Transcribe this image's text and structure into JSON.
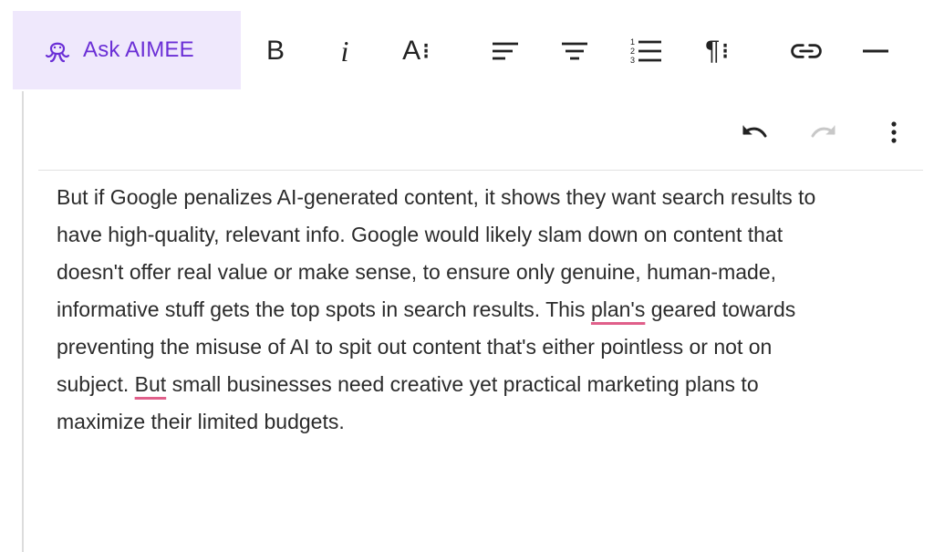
{
  "toolbar": {
    "ask_aimee_label": "Ask AIMEE",
    "bold_label": "B",
    "italic_label": "i",
    "font_size_label": "A",
    "font_size_dots": "⁝",
    "paragraph_label": "¶",
    "paragraph_dots": "⁝",
    "icons": {
      "ask_aimee": "octopus-icon",
      "align_left": "align-left-icon",
      "align_center": "align-center-icon",
      "numbered_list": "numbered-list-icon",
      "link": "link-icon",
      "horizontal_rule": "horizontal-rule-icon",
      "undo": "undo-icon",
      "redo": "redo-icon",
      "more": "more-vertical-icon"
    },
    "colors": {
      "accent": "#6b2fd6",
      "accent_bg": "#efe8fc",
      "disabled": "#c8c8c8",
      "spellcheck": "#e05f8a"
    }
  },
  "editor": {
    "lines": [
      "But if Google penalizes AI-generated content, it shows they want search results to",
      "have high-quality, relevant info. Google would likely slam down on content that",
      "doesn't offer real value or make sense, to ensure only genuine, human-made,"
    ],
    "line4_before": "informative stuff gets the top spots in search results. This ",
    "line4_flagged": "plan's",
    "line4_after": " geared towards",
    "line5": "preventing the misuse of AI to spit out content that's either pointless or not on",
    "line6_before": "subject. ",
    "line6_flagged": "But",
    "line6_after": " small businesses need creative yet practical marketing plans to",
    "line7": "maximize their limited budgets."
  }
}
